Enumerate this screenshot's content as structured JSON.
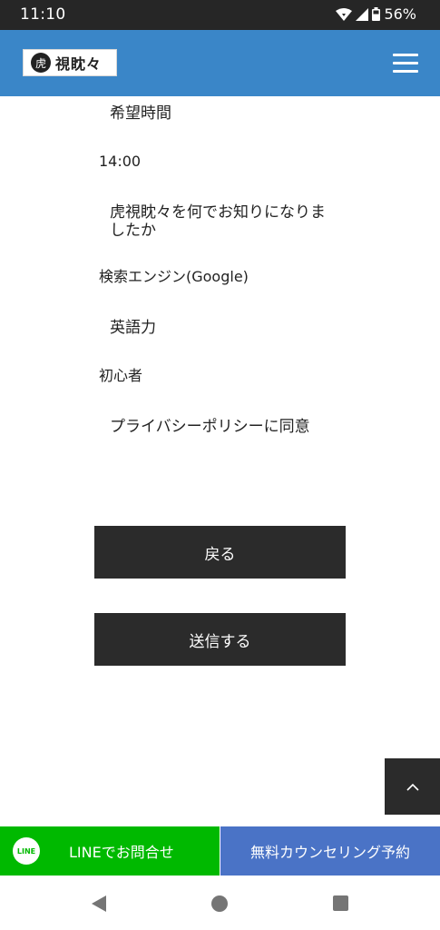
{
  "status_bar": {
    "time": "11:10",
    "battery": "56%"
  },
  "header": {
    "logo_mark": "虎",
    "logo_text": "視眈々"
  },
  "fields": [
    {
      "label": "希望時間",
      "value": "14:00"
    },
    {
      "label": "虎視眈々を何でお知りになりましたか",
      "value": "検索エンジン(Google)"
    },
    {
      "label": "英語力",
      "value": "初心者"
    },
    {
      "label": "プライバシーポリシーに同意",
      "value": ""
    }
  ],
  "buttons": {
    "back": "戻る",
    "submit": "送信する"
  },
  "cta": {
    "line_icon": "LINE",
    "line_label": "LINEでお問合せ",
    "counsel_label": "無料カウンセリング予約"
  },
  "colors": {
    "header_bg": "#3a86c8",
    "line_green": "#00b900",
    "counsel_blue": "#4a73c6",
    "button_dark": "#2b2b2b"
  }
}
